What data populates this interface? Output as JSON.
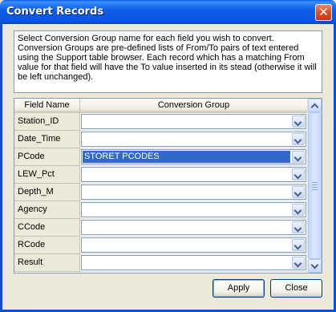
{
  "window": {
    "title": "Convert Records",
    "close_glyph": "✕"
  },
  "instructions": "Select Conversion Group name for each field you wish to convert. Conversion Groups are pre-defined lists of From/To pairs of text entered using the Support table browser. Each record which has a matching From value for that field will have the To value inserted in its stead (otherwise it will be left unchanged).",
  "grid": {
    "columns": [
      "Field Name",
      "Conversion Group"
    ],
    "rows": [
      {
        "field": "Station_ID",
        "group": "",
        "selected": false
      },
      {
        "field": "Date_Time",
        "group": "",
        "selected": false
      },
      {
        "field": "PCode",
        "group": "STORET PCODES",
        "selected": true
      },
      {
        "field": "LEW_Pct",
        "group": "",
        "selected": false
      },
      {
        "field": "Depth_M",
        "group": "",
        "selected": false
      },
      {
        "field": "Agency",
        "group": "",
        "selected": false
      },
      {
        "field": "CCode",
        "group": "",
        "selected": false
      },
      {
        "field": "RCode",
        "group": "",
        "selected": false
      },
      {
        "field": "Result",
        "group": "",
        "selected": false
      }
    ]
  },
  "buttons": {
    "apply": "Apply",
    "close": "Close"
  },
  "icons": {
    "dropdown": "chevron-down-icon",
    "scroll_up": "scroll-up-icon",
    "scroll_down": "scroll-down-icon"
  }
}
